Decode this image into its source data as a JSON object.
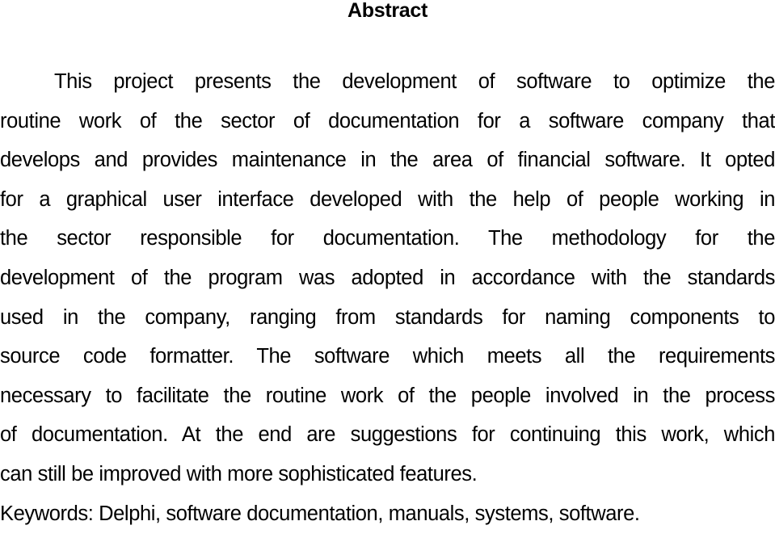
{
  "document": {
    "title": "Abstract",
    "lines": [
      "This project presents the development of software to optimize the",
      "routine work of the sector of documentation for a software company that",
      "develops and provides maintenance in the area of financial software. It opted",
      "for a graphical user interface developed with the help of people working in",
      "the sector responsible for documentation. The methodology for the",
      "development of the program was adopted in accordance with the standards",
      "used in the company, ranging from standards for naming components to",
      "source code formatter. The software which meets all the requirements",
      "necessary to facilitate the routine work of the people involved in the process",
      "of documentation. At the end are suggestions for continuing this work, which",
      "can still be improved with more sophisticated features."
    ],
    "keywords_line": "Keywords: Delphi, software documentation, manuals, systems, software."
  }
}
